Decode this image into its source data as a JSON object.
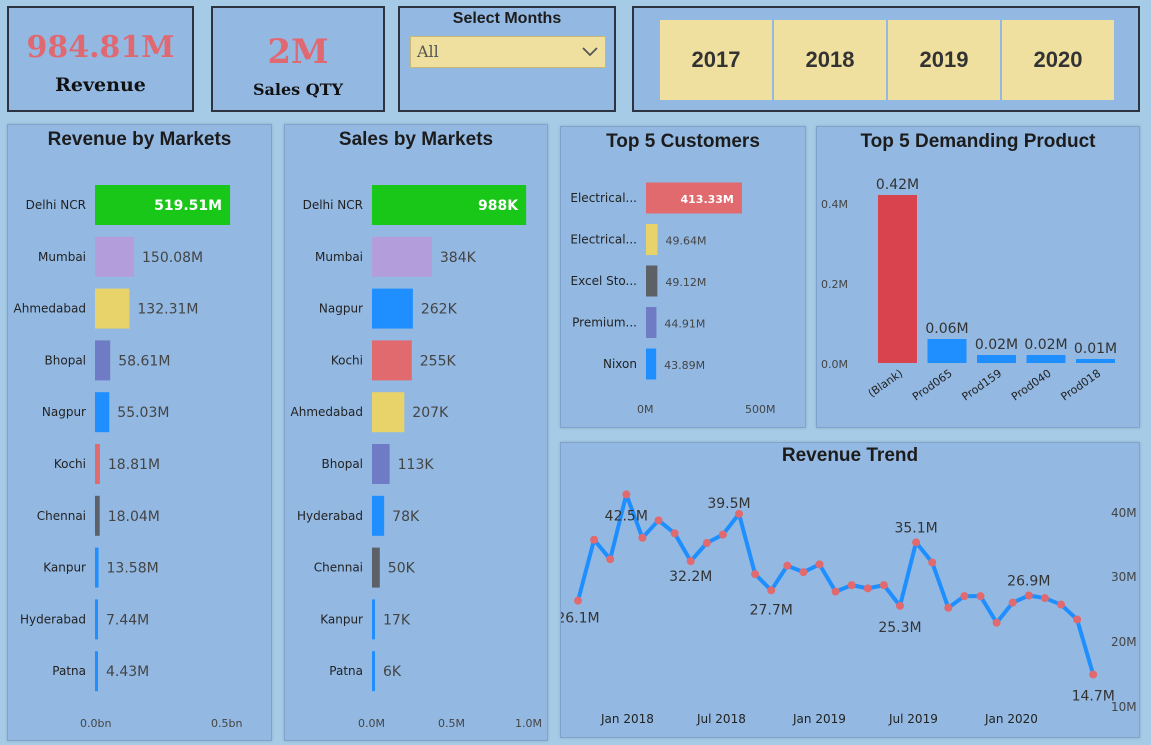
{
  "kpis": {
    "revenue": {
      "value": "984.81M",
      "label": "Revenue"
    },
    "sales_qty": {
      "value": "2M",
      "label": "Sales QTY"
    }
  },
  "month_filter": {
    "label": "Select Months",
    "selected": "All"
  },
  "year_slicer": {
    "years": [
      "2017",
      "2018",
      "2019",
      "2020"
    ]
  },
  "colors": {
    "green": "#18c718",
    "purple": "#b39ddb",
    "yellow": "#e8d36a",
    "slate": "#6f7bc4",
    "blue": "#1f8fff",
    "red": "#e06a6e",
    "gray": "#5d6066",
    "bar_red": "#d9434d"
  },
  "revenue_by_markets": {
    "title": "Revenue by Markets",
    "axis_ticks": [
      "0.0bn",
      "0.5bn"
    ]
  },
  "sales_by_markets": {
    "title": "Sales by Markets",
    "axis_ticks": [
      "0.0M",
      "0.5M",
      "1.0M"
    ]
  },
  "top_customers": {
    "title": "Top 5 Customers",
    "axis_ticks": [
      "0M",
      "500M"
    ]
  },
  "top_products": {
    "title": "Top 5 Demanding Product",
    "axis_ticks": [
      "0.4M",
      "0.2M",
      "0.0M"
    ]
  },
  "revenue_trend": {
    "title": "Revenue Trend",
    "x_ticks": [
      "Jan 2018",
      "Jul 2018",
      "Jan 2019",
      "Jul 2019",
      "Jan 2020"
    ],
    "y_ticks": [
      "40M",
      "30M",
      "20M",
      "10M"
    ],
    "point_labels": [
      {
        "label": "26.1M",
        "index": 0
      },
      {
        "label": "42.5M",
        "index": 3
      },
      {
        "label": "32.2M",
        "index": 7
      },
      {
        "label": "39.5M",
        "index": 10
      },
      {
        "label": "27.7M",
        "index": 12
      },
      {
        "label": "35.1M",
        "index": 21
      },
      {
        "label": "25.3M",
        "index": 20
      },
      {
        "label": "26.9M",
        "index": 28
      },
      {
        "label": "14.7M",
        "index": 32
      }
    ]
  },
  "chart_data": [
    {
      "type": "bar",
      "title": "Revenue by Markets",
      "orientation": "horizontal",
      "categories": [
        "Delhi NCR",
        "Mumbai",
        "Ahmedabad",
        "Bhopal",
        "Nagpur",
        "Kochi",
        "Chennai",
        "Kanpur",
        "Hyderabad",
        "Patna"
      ],
      "values": [
        519.51,
        150.08,
        132.31,
        58.61,
        55.03,
        18.81,
        18.04,
        13.58,
        7.44,
        4.43
      ],
      "labels": [
        "519.51M",
        "150.08M",
        "132.31M",
        "58.61M",
        "55.03M",
        "18.81M",
        "18.04M",
        "13.58M",
        "7.44M",
        "4.43M"
      ],
      "unit": "M",
      "bar_colors": [
        "green",
        "purple",
        "yellow",
        "slate",
        "blue",
        "red",
        "gray",
        "blue",
        "blue",
        "blue"
      ],
      "xlim": [
        0,
        700
      ]
    },
    {
      "type": "bar",
      "title": "Sales by Markets",
      "orientation": "horizontal",
      "categories": [
        "Delhi NCR",
        "Mumbai",
        "Nagpur",
        "Kochi",
        "Ahmedabad",
        "Bhopal",
        "Hyderabad",
        "Chennai",
        "Kanpur",
        "Patna"
      ],
      "values": [
        988,
        384,
        262,
        255,
        207,
        113,
        78,
        50,
        17,
        6
      ],
      "labels": [
        "988K",
        "384K",
        "262K",
        "255K",
        "207K",
        "113K",
        "78K",
        "50K",
        "17K",
        "6K"
      ],
      "unit": "K",
      "bar_colors": [
        "green",
        "purple",
        "blue",
        "red",
        "yellow",
        "slate",
        "blue",
        "gray",
        "blue",
        "blue"
      ],
      "xlim": [
        0,
        1000
      ]
    },
    {
      "type": "bar",
      "title": "Top 5 Customers",
      "orientation": "horizontal",
      "categories": [
        "Electrical...",
        "Electrical...",
        "Excel Sto...",
        "Premium...",
        "Nixon"
      ],
      "values": [
        413.33,
        49.64,
        49.12,
        44.91,
        43.89
      ],
      "labels": [
        "413.33M",
        "49.64M",
        "49.12M",
        "44.91M",
        "43.89M"
      ],
      "unit": "M",
      "bar_colors": [
        "red",
        "yellow",
        "gray",
        "slate",
        "blue"
      ],
      "xlim": [
        0,
        500
      ]
    },
    {
      "type": "bar",
      "title": "Top 5 Demanding Product",
      "orientation": "vertical",
      "categories": [
        "(Blank)",
        "Prod065",
        "Prod159",
        "Prod040",
        "Prod018"
      ],
      "values": [
        0.42,
        0.06,
        0.02,
        0.02,
        0.01
      ],
      "labels": [
        "0.42M",
        "0.06M",
        "0.02M",
        "0.02M",
        "0.01M"
      ],
      "unit": "M",
      "bar_colors": [
        "bar_red",
        "blue",
        "blue",
        "blue",
        "blue"
      ],
      "ylim": [
        0,
        0.45
      ]
    },
    {
      "type": "line",
      "title": "Revenue Trend",
      "x": [
        "2017-10",
        "2017-11",
        "2017-12",
        "2018-01",
        "2018-02",
        "2018-03",
        "2018-04",
        "2018-05",
        "2018-06",
        "2018-07",
        "2018-08",
        "2018-09",
        "2018-10",
        "2018-11",
        "2018-12",
        "2019-01",
        "2019-02",
        "2019-03",
        "2019-04",
        "2019-05",
        "2019-06",
        "2019-07",
        "2019-08",
        "2019-09",
        "2019-10",
        "2019-11",
        "2019-12",
        "2020-01",
        "2020-02",
        "2020-03",
        "2020-04",
        "2020-05",
        "2020-06"
      ],
      "y": [
        26.1,
        35.5,
        32.5,
        42.5,
        35.8,
        38.5,
        36.5,
        32.2,
        35.0,
        36.3,
        39.5,
        30.2,
        27.7,
        31.5,
        30.5,
        31.7,
        27.5,
        28.5,
        28.0,
        28.5,
        25.3,
        35.1,
        32.0,
        25.0,
        26.8,
        26.8,
        22.7,
        25.8,
        26.9,
        26.5,
        25.5,
        23.2,
        14.7
      ],
      "ylim": [
        10,
        45
      ],
      "ylabel": "",
      "xlabel": ""
    }
  ]
}
